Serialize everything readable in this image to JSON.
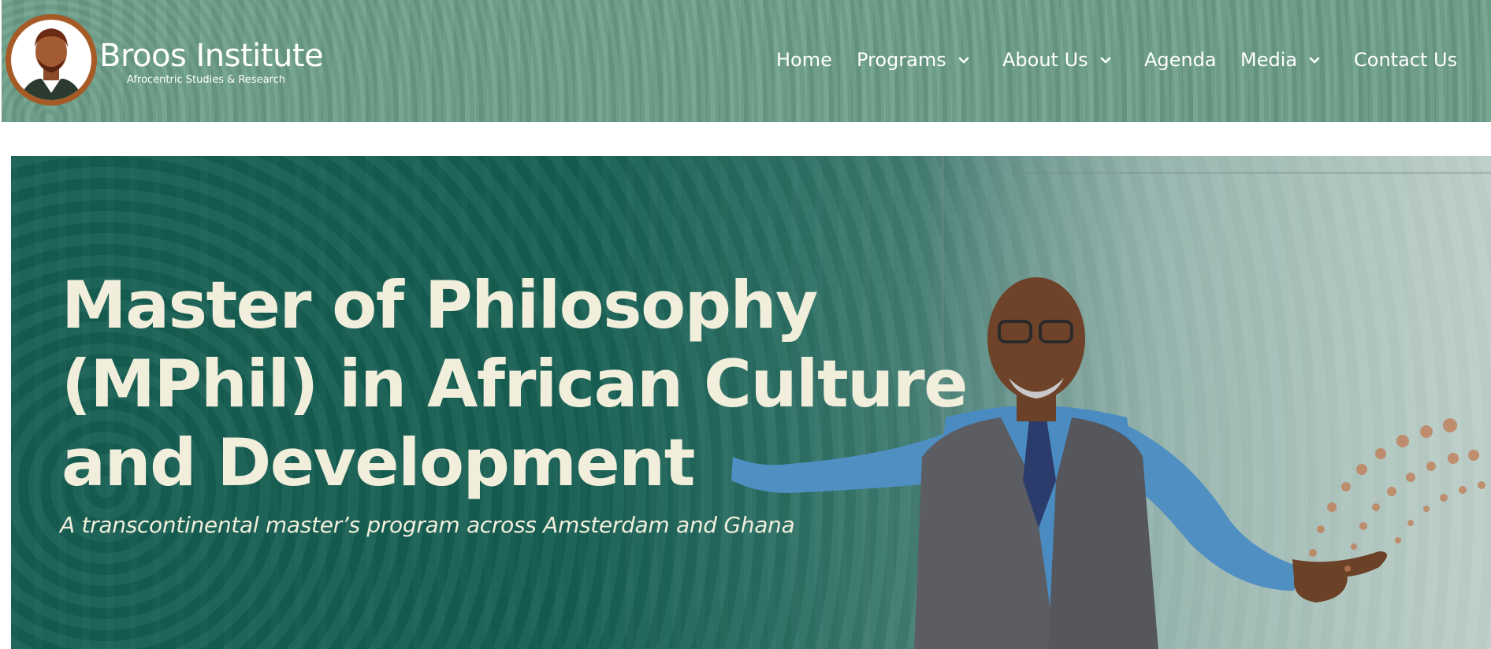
{
  "header": {
    "brand_name": "Broos Institute",
    "brand_tagline": "Afrocentric Studies & Research",
    "logo_icon": "portrait-logo-icon",
    "nav": [
      {
        "label": "Home",
        "has_dropdown": false
      },
      {
        "label": "Programs",
        "has_dropdown": true
      },
      {
        "label": "About Us",
        "has_dropdown": true
      },
      {
        "label": "Agenda",
        "has_dropdown": false
      },
      {
        "label": "Media",
        "has_dropdown": true
      },
      {
        "label": "Contact Us",
        "has_dropdown": false
      }
    ]
  },
  "hero": {
    "title_lines": [
      "Master of Philosophy",
      "(MPhil) in African Culture",
      "and Development"
    ],
    "subtitle": "A transcontinental master’s program across Amsterdam and Ghana"
  },
  "colors": {
    "header_bg": "#6a9d87",
    "hero_bg": "#165e52",
    "hero_text": "#f1eedc",
    "accent_dots": "#c07a52"
  }
}
